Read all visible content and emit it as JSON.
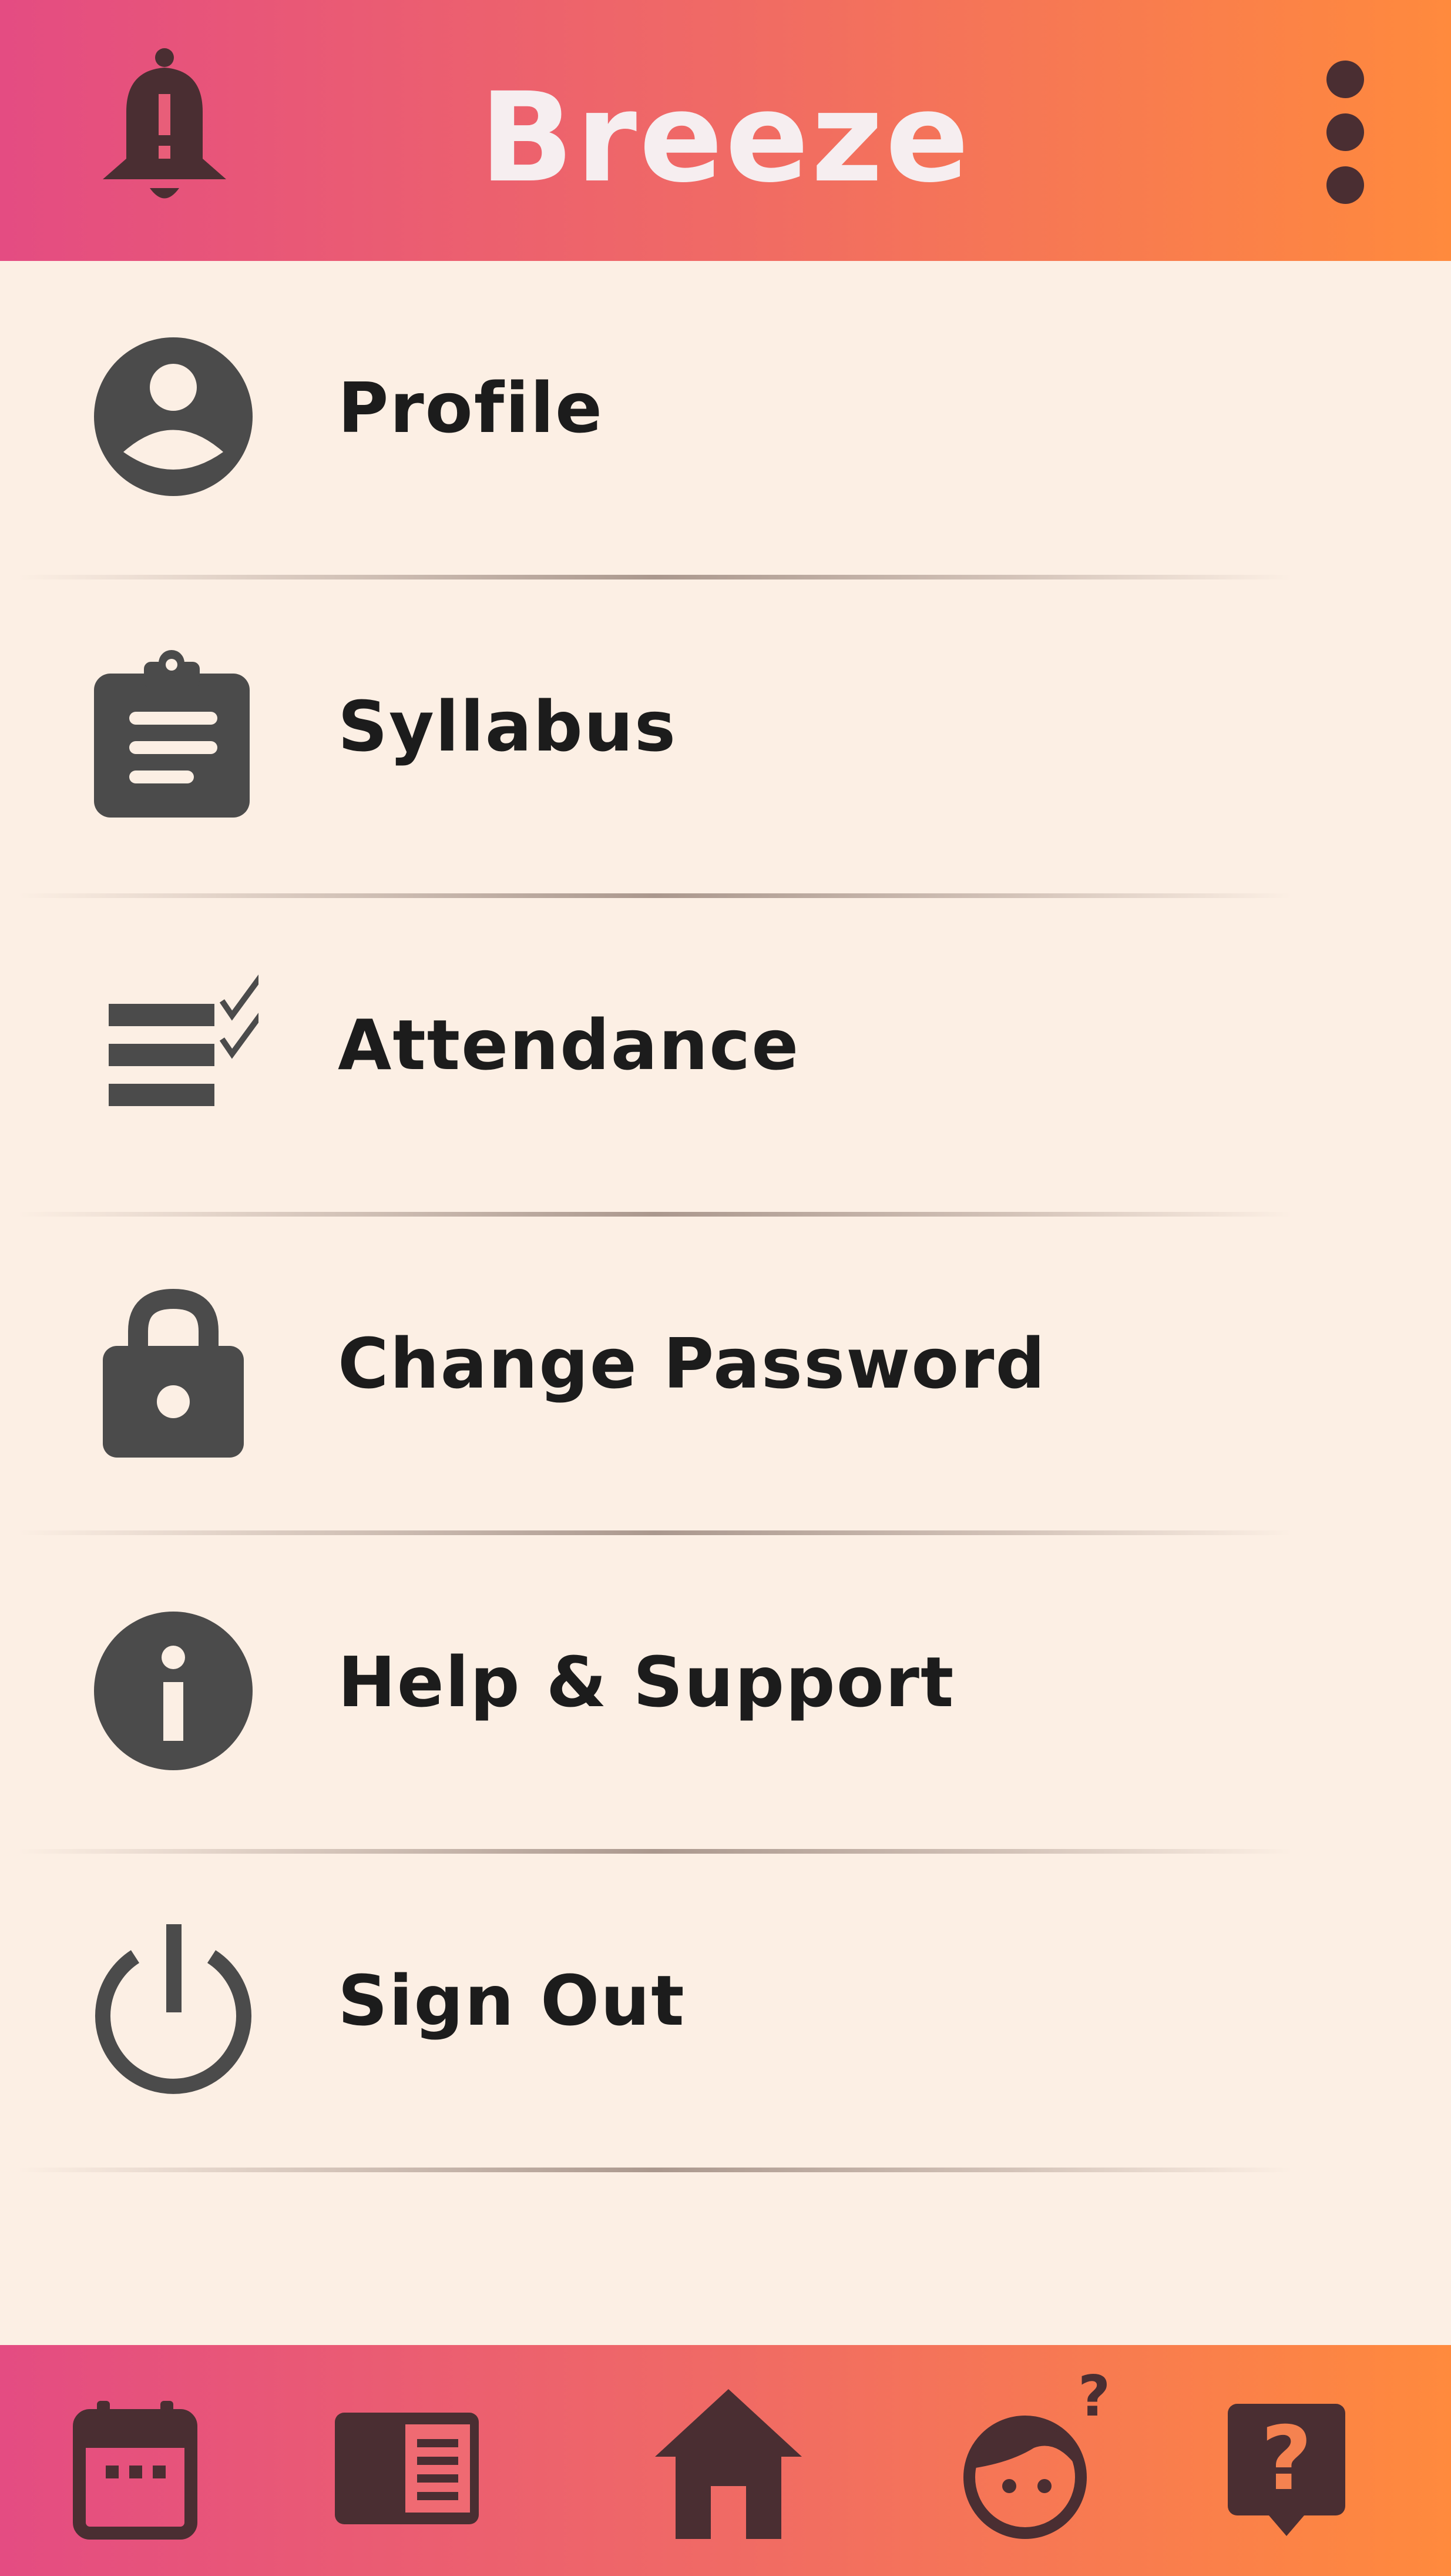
{
  "app": {
    "title": "Breeze"
  },
  "colors": {
    "accent_start": "#e44c82",
    "accent_end": "#ff8a3d",
    "icon": "#4b4b4b",
    "dark_icon": "#4a2e32",
    "background": "#fcefe4"
  },
  "topbar": {
    "left_icon": "bell-alert-icon",
    "right_icon": "more-vertical-icon"
  },
  "menu": {
    "items": [
      {
        "label": "Profile",
        "icon": "profile-icon"
      },
      {
        "label": "Syllabus",
        "icon": "clipboard-icon"
      },
      {
        "label": "Attendance",
        "icon": "checklist-icon"
      },
      {
        "label": "Change Password",
        "icon": "lock-icon"
      },
      {
        "label": "Help & Support",
        "icon": "info-icon"
      },
      {
        "label": "Sign Out",
        "icon": "power-icon"
      }
    ]
  },
  "bottom_nav": {
    "items": [
      {
        "icon": "calendar-icon"
      },
      {
        "icon": "book-icon"
      },
      {
        "icon": "home-icon"
      },
      {
        "icon": "kid-question-icon"
      },
      {
        "icon": "help-chat-icon"
      }
    ]
  }
}
